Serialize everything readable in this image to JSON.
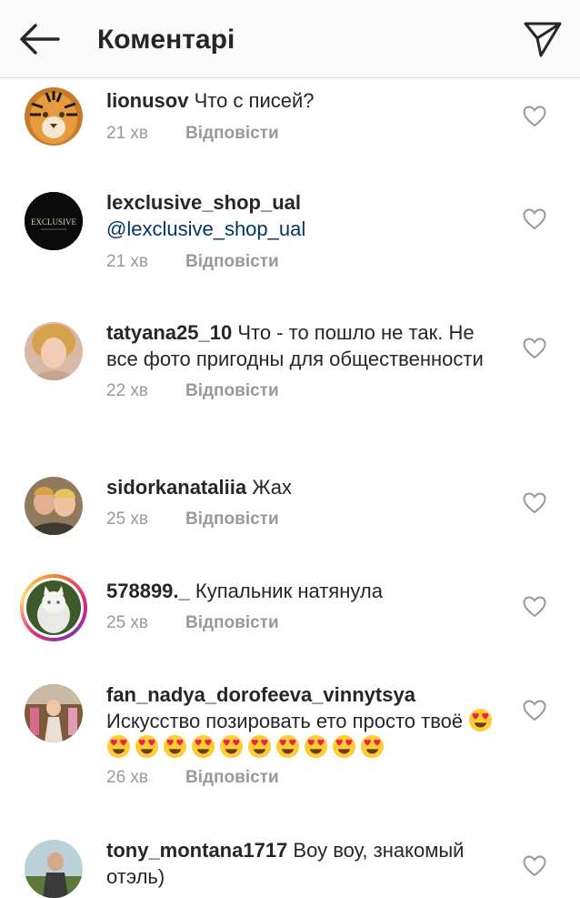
{
  "header": {
    "title": "Коментарі",
    "back_icon": "arrow-left-icon",
    "send_icon": "paper-plane-icon"
  },
  "colors": {
    "username": "#262626",
    "mention": "#003569",
    "meta": "#999999",
    "topbar_bg": "#fafafa"
  },
  "reply_label": "Відповісти",
  "comments": [
    {
      "username": "lionusov",
      "text": "Что с писей?",
      "time": "21 хв"
    },
    {
      "username": "lexclusive_shop_ual",
      "text": "@lexclusive_shop_ual",
      "time": "21 хв",
      "avatar_text": "EXCLUSIVE"
    },
    {
      "username": "tatyana25_10",
      "text": "Что - то пошло не так. Не все фото пригодны для общественности",
      "time": "22 хв"
    },
    {
      "username": "sidorkanataliia",
      "text": "Жах",
      "time": "25 хв"
    },
    {
      "username": "578899._",
      "text": "Купальник натянула",
      "time": "25 хв"
    },
    {
      "username": "fan_nadya_dorofeeva_vinnytsya",
      "text": "Искусство позировать ето просто твоё",
      "time": "26 хв",
      "emoji": "heart-eyes-emoji",
      "emoji_count": 11
    },
    {
      "username": "tony_montana1717",
      "text": "Воу воу, знакомый отэль)",
      "time": ""
    }
  ]
}
